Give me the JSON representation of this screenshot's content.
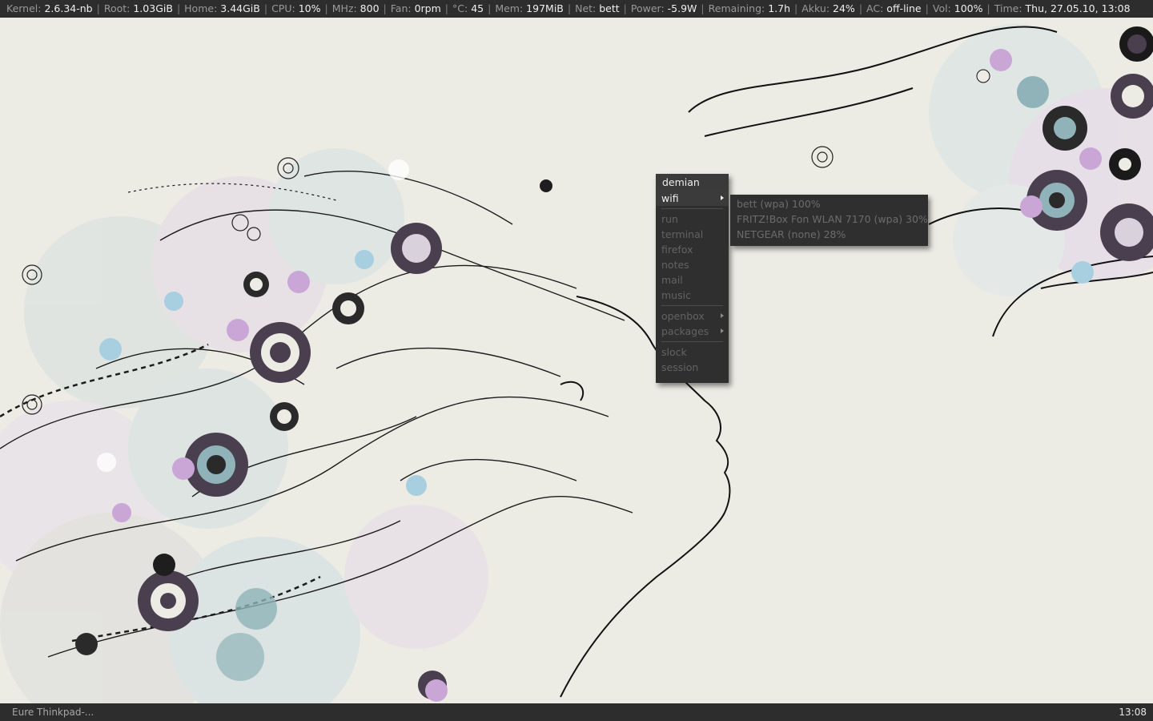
{
  "status_bar": {
    "items": [
      {
        "label": "Kernel:",
        "value": "2.6.34-nb"
      },
      {
        "label": "Root:",
        "value": "1.03GiB"
      },
      {
        "label": "Home:",
        "value": "3.44GiB"
      },
      {
        "label": "CPU:",
        "value": "10%"
      },
      {
        "label": "MHz:",
        "value": "800"
      },
      {
        "label": "Fan:",
        "value": "0rpm"
      },
      {
        "label": "°C:",
        "value": "45"
      },
      {
        "label": "Mem:",
        "value": "197MiB"
      },
      {
        "label": "Net:",
        "value": "bett"
      },
      {
        "label": "Power:",
        "value": "-5.9W"
      },
      {
        "label": "Remaining:",
        "value": "1.7h"
      },
      {
        "label": "Akku:",
        "value": "24%"
      },
      {
        "label": "AC:",
        "value": "off-line"
      },
      {
        "label": "Vol:",
        "value": "100%"
      },
      {
        "label": "Time:",
        "value": "Thu, 27.05.10, 13:08"
      }
    ],
    "separator": "|"
  },
  "root_menu": {
    "title": "demian",
    "items": [
      {
        "label": "wifi",
        "submenu": true,
        "active": true
      },
      {
        "separator": true
      },
      {
        "label": "run"
      },
      {
        "label": "terminal"
      },
      {
        "label": "firefox"
      },
      {
        "label": "notes"
      },
      {
        "label": "mail"
      },
      {
        "label": "music"
      },
      {
        "separator": true
      },
      {
        "label": "openbox",
        "submenu": true
      },
      {
        "label": "packages",
        "submenu": true
      },
      {
        "separator": true
      },
      {
        "label": "slock"
      },
      {
        "label": "session"
      }
    ]
  },
  "wifi_menu": {
    "items": [
      {
        "label": "bett (wpa) 100%"
      },
      {
        "label": "FRITZ!Box Fon WLAN 7170 (wpa) 30%"
      },
      {
        "label": "NETGEAR (none) 28%"
      }
    ]
  },
  "bottom_bar": {
    "task": "Eure Thinkpad-...",
    "clock": "13:08"
  },
  "colors": {
    "bar_bg": "#2d2d2d",
    "menu_bg": "#2f2f2f",
    "desktop_bg": "#ecebe4",
    "accent_teal": "#8fb3b8",
    "accent_purple": "#c9a6d6",
    "accent_dark": "#4a3f4f"
  }
}
